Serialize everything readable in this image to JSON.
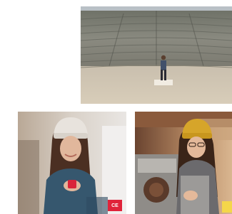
{
  "photos": [
    {
      "name": "amphitheater-photo",
      "description_hidden": ""
    },
    {
      "name": "woman-phone-photo"
    },
    {
      "name": "barista-photo"
    }
  ],
  "badges": {
    "ce_label": "CE",
    "ce_color": "#e0233a",
    "yellow_color": "#f4d64a"
  }
}
